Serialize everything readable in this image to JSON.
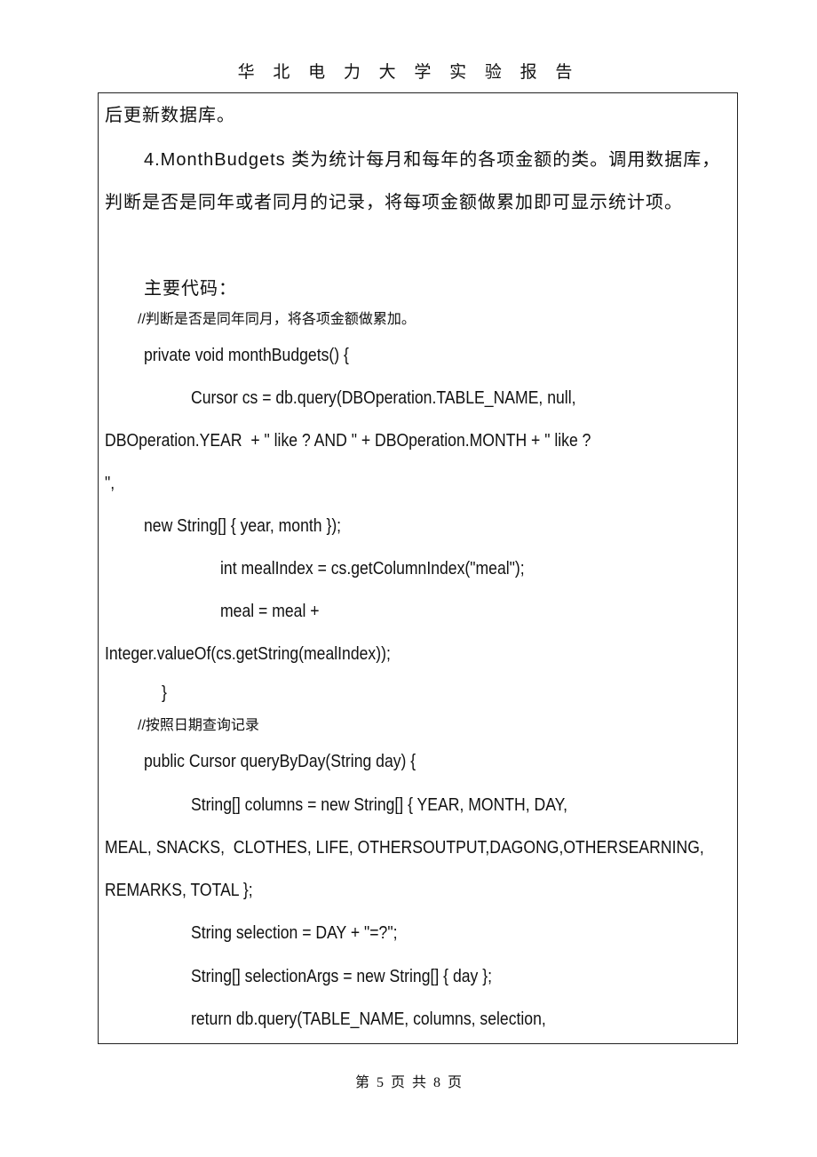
{
  "header": {
    "title": "华 北 电 力 大 学 实 验 报 告"
  },
  "body": {
    "lines": [
      "后更新数据库。",
      "4.MonthBudgets 类为统计每月和每年的各项金额的类。调用数据库，",
      "判断是否是同年或者同月的记录，将每项金额做累加即可显示统计项。",
      "主要代码：",
      "//判断是否是同年同月，将各项金额做累加。",
      "private void monthBudgets() {",
      "Cursor cs = db.query(DBOperation.TABLE_NAME, null,",
      "DBOperation.YEAR  + \" like ? AND \" + DBOperation.MONTH + \" like ?",
      "\",",
      "new String[] { year, month });",
      "int mealIndex = cs.getColumnIndex(\"meal\");",
      "meal = meal +",
      "Integer.valueOf(cs.getString(mealIndex));",
      "}",
      "//按照日期查询记录",
      "public Cursor queryByDay(String day) {",
      "String[] columns = new String[] { YEAR, MONTH, DAY,",
      "MEAL, SNACKS,  CLOTHES, LIFE, OTHERSOUTPUT,DAGONG,OTHERSEARNING,",
      "REMARKS, TOTAL };",
      "String selection = DAY + \"=?\";",
      "String[] selectionArgs = new String[] { day };",
      "return db.query(TABLE_NAME, columns, selection,"
    ]
  },
  "footer": {
    "page": "第 5 页 共 8 页"
  }
}
